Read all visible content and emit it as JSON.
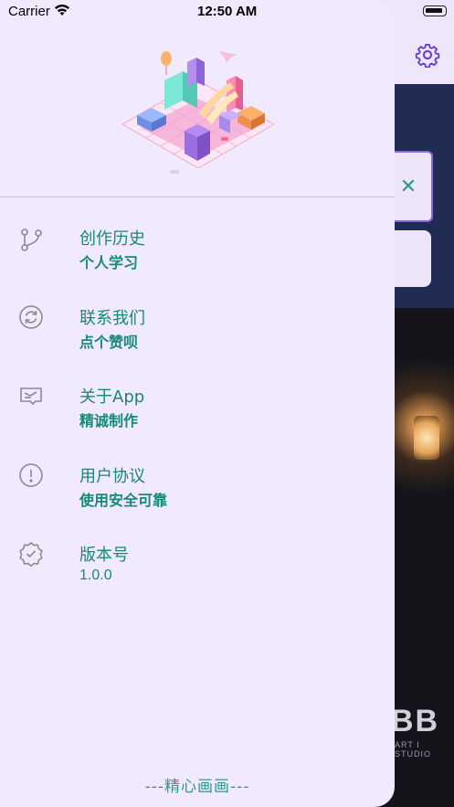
{
  "status_bar": {
    "carrier": "Carrier",
    "time": "12:50 AM"
  },
  "menu": {
    "items": [
      {
        "title": "创作历史",
        "subtitle": "个人学习",
        "icon": "branch-icon"
      },
      {
        "title": "联系我们",
        "subtitle": "点个赞呗",
        "icon": "sync-circle-icon"
      },
      {
        "title": "关于App",
        "subtitle": "精诚制作",
        "icon": "message-box-icon"
      },
      {
        "title": "用户协议",
        "subtitle": "使用安全可靠",
        "icon": "alert-circle-icon"
      },
      {
        "title": "版本号",
        "value": "1.0.0",
        "icon": "badge-check-icon"
      }
    ]
  },
  "footer": {
    "text": "---精心画画---"
  },
  "background": {
    "logo_text": "BB",
    "logo_sub": "ART I STUDIO",
    "card_icon": "close-icon"
  },
  "colors": {
    "accent": "#17887a",
    "drawer_bg": "#f1e9fd",
    "gear": "#6a3fd2"
  }
}
